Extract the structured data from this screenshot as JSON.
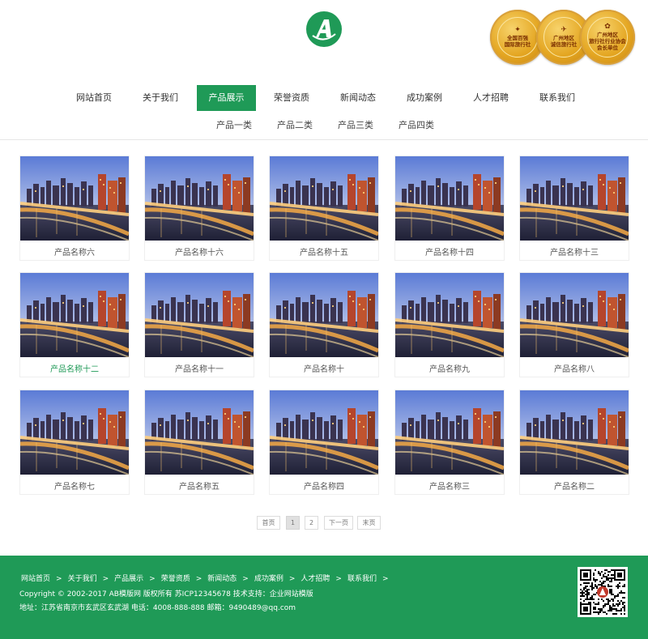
{
  "header": {
    "logo_letter": "A",
    "medals": [
      {
        "text": "全国百强\n国际旅行社"
      },
      {
        "text": "广州地区\n诚信旅行社"
      },
      {
        "text": "广州地区\n旅行社行业协会\n会长单位"
      }
    ]
  },
  "nav": {
    "items": [
      "网站首页",
      "关于我们",
      "产品展示",
      "荣誉资质",
      "新闻动态",
      "成功案例",
      "人才招聘",
      "联系我们"
    ],
    "active_index": 2
  },
  "subnav": {
    "items": [
      "产品一类",
      "产品二类",
      "产品三类",
      "产品四类"
    ]
  },
  "products": [
    "产品名称六",
    "产品名称十六",
    "产品名称十五",
    "产品名称十四",
    "产品名称十三",
    "产品名称十二",
    "产品名称十一",
    "产品名称十",
    "产品名称九",
    "产品名称八",
    "产品名称七",
    "产品名称五",
    "产品名称四",
    "产品名称三",
    "产品名称二"
  ],
  "highlighted_product_index": 5,
  "pagination": {
    "first": "首页",
    "pages": [
      "1",
      "2"
    ],
    "current": "1",
    "next": "下一页",
    "last": "末页"
  },
  "footer": {
    "links": [
      "网站首页",
      "关于我们",
      "产品展示",
      "荣誉资质",
      "新闻动态",
      "成功案例",
      "人才招聘",
      "联系我们"
    ],
    "separator": ">",
    "copyright": "Copyright © 2002-2017 AB模版网 版权所有  苏ICP12345678  技术支持：企业网站模版",
    "address": "地址：江苏省南京市玄武区玄武湖   电话：4008-888-888    邮箱：9490489@qq.com"
  },
  "colors": {
    "brand_green": "#1f9a57",
    "medal_gold": "#e4a622"
  },
  "icons": {
    "logo": "letter-a-logo-icon",
    "qr": "qr-code-icon"
  }
}
